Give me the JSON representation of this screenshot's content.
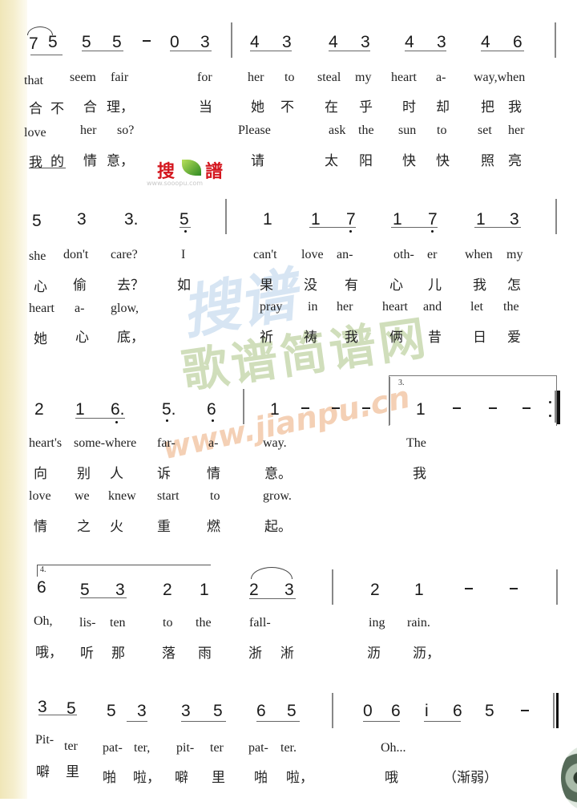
{
  "watermarks": {
    "logo_left": "搜",
    "logo_right": "譜",
    "logo_url": "www.sooopu.com",
    "big_text": "歌谱简谱网",
    "script_text": "搜谱",
    "url": "www.jianpu.cn"
  },
  "systems": [
    {
      "notes": [
        "7",
        "5",
        "5",
        "5",
        "-",
        "0",
        "3",
        "4",
        "3",
        "4",
        "3",
        "4",
        "3",
        "4",
        "6"
      ],
      "lyrics_en_1": [
        "that",
        "seem",
        "fair",
        "for",
        "her",
        "to",
        "steal",
        "my",
        "heart",
        "a-",
        "way,when"
      ],
      "lyrics_zh_1": [
        "合",
        "不",
        "合",
        "理，",
        "当",
        "她",
        "不",
        "在",
        "乎",
        "时",
        "却",
        "把",
        "我"
      ],
      "lyrics_en_2": [
        "love",
        "her",
        "so?",
        "Please",
        "ask",
        "the",
        "sun",
        "to",
        "set",
        "her"
      ],
      "lyrics_zh_2": [
        "我",
        "的",
        "情",
        "意，",
        "请",
        "太",
        "阳",
        "快",
        "快",
        "照",
        "亮"
      ]
    },
    {
      "notes": [
        "5",
        "3",
        "3.",
        "5",
        "1",
        "1",
        "7",
        "1",
        "7",
        "1",
        "3"
      ],
      "lyrics_en_1": [
        "she",
        "don't",
        "care?",
        "I",
        "can't",
        "love",
        "an-",
        "oth-",
        "er",
        "when",
        "my"
      ],
      "lyrics_zh_1": [
        "心",
        "偷",
        "去？",
        "如",
        "果",
        "没",
        "有",
        "心",
        "儿",
        "我",
        "怎"
      ],
      "lyrics_en_2": [
        "heart",
        "a-",
        "glow,",
        "pray",
        "in",
        "her",
        "heart",
        "and",
        "let",
        "the"
      ],
      "lyrics_zh_2": [
        "她",
        "心",
        "底，",
        "祈",
        "祷",
        "我",
        "俩",
        "昔",
        "日",
        "爱"
      ]
    },
    {
      "volta": "3.",
      "notes": [
        "2",
        "1",
        "6.",
        "5.",
        "6",
        "1",
        "-",
        "-",
        "-",
        "1",
        "-",
        "-",
        "-"
      ],
      "lyrics_en_1": [
        "heart's",
        "some-where",
        "far-",
        "a-",
        "way.",
        "The"
      ],
      "lyrics_zh_1": [
        "向",
        "别",
        "人",
        "诉",
        "情",
        "意。",
        "我"
      ],
      "lyrics_en_2": [
        "love",
        "we",
        "knew",
        "start",
        "to",
        "grow."
      ],
      "lyrics_zh_2": [
        "情",
        "之",
        "火",
        "重",
        "燃",
        "起。"
      ]
    },
    {
      "volta": "4.",
      "notes": [
        "6",
        "5",
        "3",
        "2",
        "1",
        "2",
        "3",
        "2",
        "1",
        "-",
        "-"
      ],
      "lyrics_en_1": [
        "Oh,",
        "lis-",
        "ten",
        "to",
        "the",
        "fall-",
        "ing",
        "rain."
      ],
      "lyrics_zh_1": [
        "哦，",
        "听",
        "那",
        "落",
        "雨",
        "浙",
        "淅",
        "沥",
        "沥，"
      ]
    },
    {
      "notes": [
        "3",
        "5",
        "5",
        "3",
        "3",
        "5",
        "6",
        "5",
        "0",
        "6",
        "i",
        "6",
        "5",
        "-"
      ],
      "lyrics_en_1": [
        "Pit-",
        "ter",
        "pat-",
        "ter,",
        "pit-",
        "ter",
        "pat-",
        "ter.",
        "Oh..."
      ],
      "lyrics_zh_1": [
        "噼",
        "里",
        "啪",
        "啦，",
        "噼",
        "里",
        "啪",
        "啦，",
        "哦"
      ],
      "dynamic": "渐弱"
    }
  ]
}
